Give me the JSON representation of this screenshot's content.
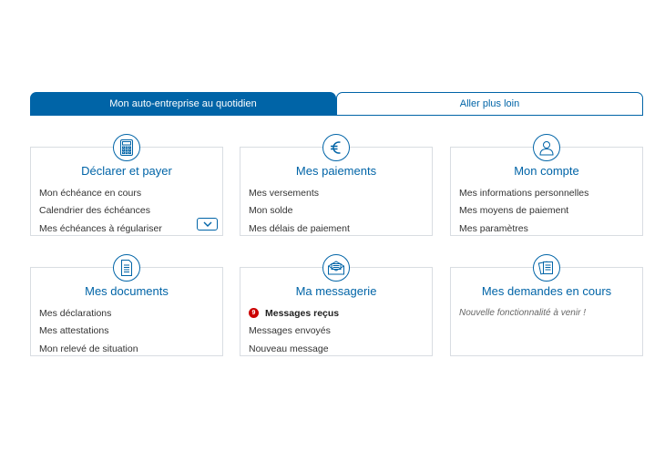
{
  "tabs": {
    "active": "Mon auto-entreprise au quotidien",
    "inactive": "Aller plus loin"
  },
  "cards": [
    {
      "title": "Déclarer et payer",
      "icon": "calculator-icon",
      "links": [
        "Mon échéance en cours",
        "Calendrier des échéances",
        "Mes échéances à régulariser"
      ]
    },
    {
      "title": "Mes paiements",
      "icon": "euro-icon",
      "links": [
        "Mes versements",
        "Mon solde",
        "Mes délais de paiement"
      ]
    },
    {
      "title": "Mon compte",
      "icon": "user-icon",
      "links": [
        "Mes informations personnelles",
        "Mes moyens de paiement",
        "Mes paramètres"
      ]
    },
    {
      "title": "Mes documents",
      "icon": "document-icon",
      "links": [
        "Mes déclarations",
        "Mes attestations",
        "Mon relevé de situation"
      ]
    },
    {
      "title": "Ma messagerie",
      "icon": "envelope-icon",
      "unread_count": "9",
      "links": [
        "Messages reçus",
        "Messages envoyés",
        "Nouveau message"
      ]
    },
    {
      "title": "Mes demandes en cours",
      "icon": "requests-icon",
      "note": "Nouvelle fonctionnalité à venir !"
    }
  ],
  "colors": {
    "accent": "#0064a7",
    "border": "#d9dde2",
    "badge": "#cc0000"
  }
}
